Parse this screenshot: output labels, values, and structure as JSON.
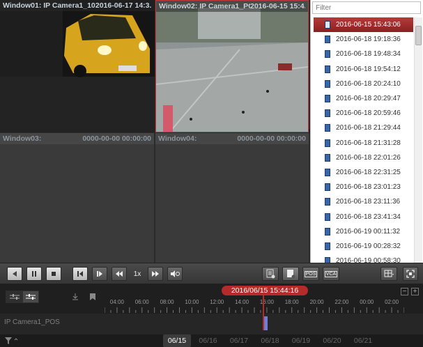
{
  "windows": [
    {
      "name": "Window01: IP Camera1_10...",
      "time": "2016-06-17 14:3..."
    },
    {
      "name": "Window02: IP Camera1_POS",
      "time": "2016-06-15 15:4..."
    },
    {
      "name": "Window03:",
      "time": "0000-00-00 00:00:00"
    },
    {
      "name": "Window04:",
      "time": "0000-00-00 00:00:00"
    }
  ],
  "file_list": {
    "filter_placeholder": "Filter",
    "items": [
      "2016-06-15 15:43:06",
      "2016-06-18 19:18:36",
      "2016-06-18 19:48:34",
      "2016-06-18 19:54:12",
      "2016-06-18 20:24:10",
      "2016-06-18 20:29:47",
      "2016-06-18 20:59:46",
      "2016-06-18 21:29:44",
      "2016-06-18 21:31:28",
      "2016-06-18 22:01:26",
      "2016-06-18 22:31:25",
      "2016-06-18 23:01:23",
      "2016-06-18 23:11:36",
      "2016-06-18 23:41:34",
      "2016-06-19 00:11:32",
      "2016-06-19 00:28:32",
      "2016-06-19 00:58:30"
    ],
    "selected_index": 0
  },
  "toolbar": {
    "speed": "1x",
    "icons": {
      "reverse": "play-reverse-icon",
      "pause": "pause-icon",
      "stop": "stop-icon",
      "frame_back": "frame-back-icon",
      "frame_forward": "frame-forward-icon",
      "slow": "slow-icon",
      "fast": "fast-icon",
      "volume": "volume-icon",
      "download": "download-icon",
      "capture": "capture-icon",
      "pos": "pos-icon",
      "vca": "vca-icon",
      "layout": "layout-icon",
      "fullscreen": "fullscreen-icon"
    },
    "pos_label": "POS",
    "vca_label": "VCA"
  },
  "timeline": {
    "current": "2016/06/15 15:44:16",
    "ticks": [
      "04:00",
      "06:00",
      "08:00",
      "10:00",
      "12:00",
      "14:00",
      "16:00",
      "18:00",
      "20:00",
      "22:00",
      "00:00",
      "02:00"
    ],
    "camera": "IP Camera1_POS",
    "playhead_hour": 15.74,
    "dates": [
      "06/15",
      "06/16",
      "06/17",
      "06/18",
      "06/19",
      "06/20",
      "06/21"
    ],
    "active_date_index": 0
  },
  "colors": {
    "accent": "#b52a2a",
    "selected_border": "#c0393b",
    "record_block": "#6f7fd6"
  }
}
